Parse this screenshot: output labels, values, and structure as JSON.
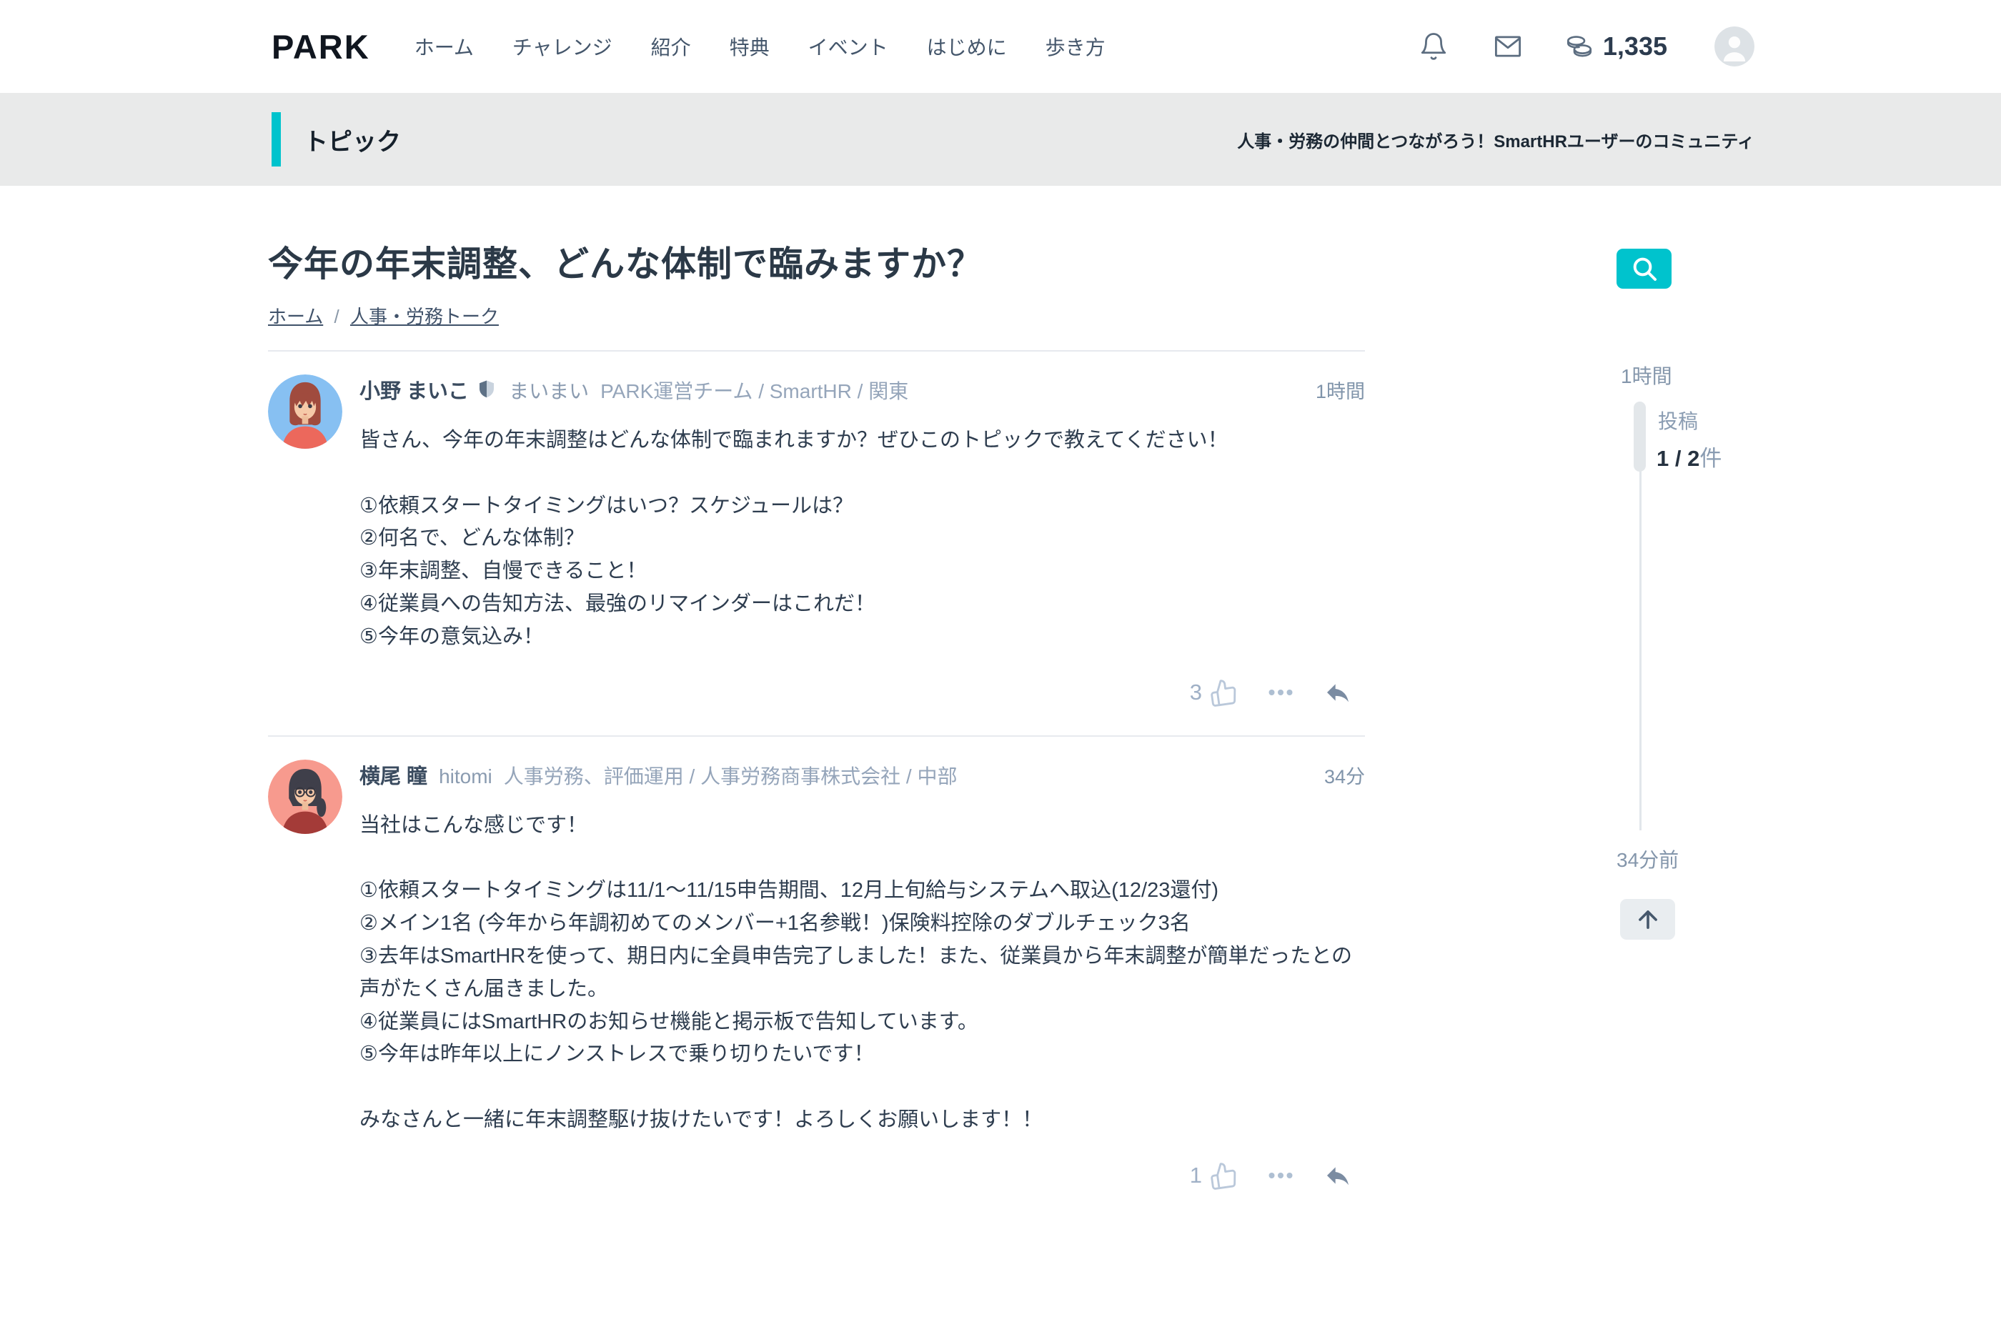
{
  "colors": {
    "accent_teal": "#00c3cd",
    "band_gray": "#e9eaea",
    "body_text": "#2e3d4f",
    "muted_text": "#8a9bb0"
  },
  "header": {
    "logo": "PARK",
    "nav": [
      "ホーム",
      "チャレンジ",
      "紹介",
      "特典",
      "イベント",
      "はじめに",
      "歩き方"
    ],
    "coin_count": "1,335"
  },
  "topic_band": {
    "title": "トピック",
    "tagline": "人事・労務の仲間とつながろう！SmartHRユーザーのコミュニティ"
  },
  "page": {
    "title": "今年の年末調整、どんな体制で臨みますか？",
    "breadcrumb_home": "ホーム",
    "breadcrumb_sep": "/",
    "breadcrumb_category": "人事・労務トーク"
  },
  "posts": [
    {
      "author": "小野 まいこ",
      "handle": "まいまい",
      "meta": "PARK運営チーム / SmartHR / 関東",
      "time": "1時間",
      "likes": "3",
      "body": "皆さん、今年の年末調整はどんな体制で臨まれますか？ぜひこのトピックで教えてください！\n\n①依頼スタートタイミングはいつ？スケジュールは？\n②何名で、どんな体制？\n③年末調整、自慢できること！\n④従業員への告知方法、最強のリマインダーはこれだ！\n⑤今年の意気込み！"
    },
    {
      "author": "横尾 瞳",
      "handle": "hitomi",
      "meta": "人事労務、評価運用 / 人事労務商事株式会社 / 中部",
      "time": "34分",
      "likes": "1",
      "body": "当社はこんな感じです！\n\n①依頼スタートタイミングは11/1〜11/15申告期間、12月上旬給与システムへ取込(12/23還付)\n②メイン1名 (今年から年調初めてのメンバー+1名参戦！)保険料控除のダブルチェック3名\n③去年はSmartHRを使って、期日内に全員申告完了しました！また、従業員から年末調整が簡単だったとの声がたくさん届きました。\n④従業員にはSmartHRのお知らせ機能と掲示板で告知しています。\n⑤今年は昨年以上にノンストレスで乗り切りたいです！\n\nみなさんと一緒に年末調整駆け抜けたいです！よろしくお願いします！！"
    }
  ],
  "sidebar": {
    "top_time": "1時間",
    "posts_label": "投稿",
    "count_current": "1",
    "count_sep": " / ",
    "count_total": "2",
    "count_unit": "件",
    "bottom_time": "34分前"
  }
}
